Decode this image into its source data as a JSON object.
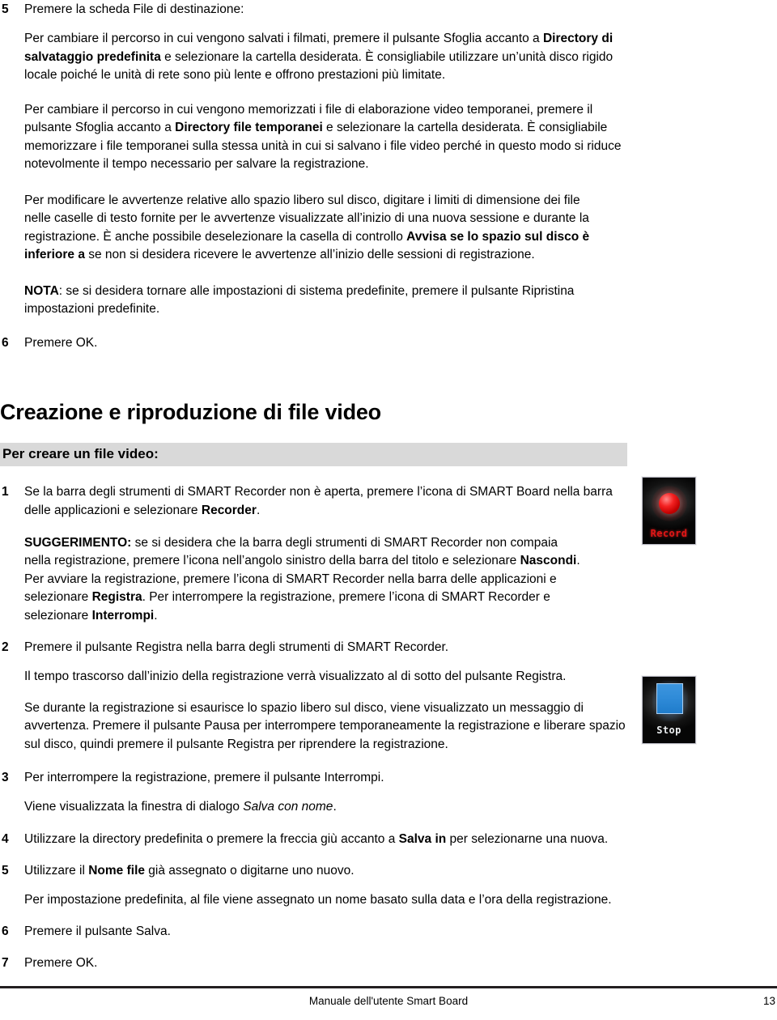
{
  "document": {
    "language": "it",
    "footer": {
      "title": "Manuale dell'utente Smart Board",
      "page_number": "13"
    }
  },
  "steps_top": {
    "step5": {
      "number": "5",
      "text": "Premere la scheda File di destinazione:"
    },
    "para_save_dir": {
      "lead": "Per cambiare il percorso in cui vengono salvati i filmati, premere il pulsante Sfoglia accanto a ",
      "bold": "Directory di salvataggio predefinita",
      "tail": " e selezionare la cartella desiderata. È consigliabile utilizzare un’unità disco rigido locale poiché le unità di rete sono più lente e offrono prestazioni più limitate."
    },
    "para_temp_dir": {
      "lead": "Per cambiare il percorso in cui vengono memorizzati i file di elaborazione video temporanei, premere il pulsante Sfoglia accanto a ",
      "bold": "Directory file temporanei",
      "tail": " e selezionare la cartella desiderata. È consigliabile memorizzare i file temporanei sulla stessa unità in cui si salvano i file video perché in questo modo si riduce notevolmente il tempo necessario per salvare la registrazione."
    },
    "para_disk_warn": {
      "lead": "Per modificare le avvertenze relative allo spazio libero sul disco, digitare i limiti di dimensione dei file nelle caselle di testo fornite per le avvertenze visualizzate all’inizio di una nuova sessione e durante la registrazione. È anche possibile deselezionare la casella di controllo ",
      "bold": "Avvisa se lo spazio sul disco è inferiore a",
      "tail": " se non si desidera ricevere le avvertenze all’inizio delle sessioni di registrazione."
    },
    "para_note": {
      "bold": "NOTA",
      "text": ": se si desidera tornare alle impostazioni di sistema predefinite, premere il pulsante Ripristina impostazioni predefinite."
    },
    "step6": {
      "number": "6",
      "text": "Premere OK."
    }
  },
  "section": {
    "heading": "Creazione e riproduzione di file video",
    "subheading_bar": "Per creare un file video:"
  },
  "steps_bottom": {
    "step1": {
      "number": "1",
      "lead": "Se la barra degli strumenti di SMART Recorder non è aperta, premere l’icona di SMART Board nella barra delle applicazioni e selezionare ",
      "bold": "Recorder",
      "tail": "."
    },
    "para_tip": {
      "bold0": "SUGGERIMENTO:",
      "seg1": " se si desidera che la barra degli strumenti di SMART Recorder non compaia nella registrazione, premere l’icona nell’angolo sinistro della barra del titolo e selezionare ",
      "bold1": "Nascondi",
      "seg2": ". Per avviare la registrazione, premere l’icona di SMART Recorder nella barra delle applicazioni e selezionare ",
      "bold2": "Registra",
      "seg3": ". Per interrompere la registrazione, premere l’icona di SMART Recorder e selezionare ",
      "bold3": "Interrompi",
      "seg4": "."
    },
    "step2": {
      "number": "2",
      "text": "Premere il pulsante Registra nella barra degli strumenti di SMART Recorder."
    },
    "para_elapsed": {
      "text": "Il tempo trascorso dall’inizio della registrazione verrà visualizzato al di sotto del pulsante Registra."
    },
    "para_diskfull": {
      "text": "Se durante la registrazione si esaurisce lo spazio libero sul disco, viene visualizzato un messaggio di avvertenza. Premere il pulsante Pausa per interrompere temporaneamente la registrazione e liberare spazio sul disco, quindi premere il pulsante Registra per riprendere la registrazione."
    },
    "step3": {
      "number": "3",
      "text": "Per interrompere la registrazione, premere il pulsante Interrompi."
    },
    "para_dialog": {
      "lead": "Viene visualizzata la finestra di dialogo ",
      "italic": "Salva con nome",
      "tail": "."
    },
    "step4": {
      "number": "4",
      "lead": "Utilizzare la directory predefinita o premere la freccia giù accanto a ",
      "bold": "Salva in",
      "tail": " per selezionarne una nuova."
    },
    "step5": {
      "number": "5",
      "lead": "Utilizzare il ",
      "bold": "Nome file",
      "tail": " già assegnato o digitarne uno nuovo."
    },
    "para_default_name": {
      "text": "Per impostazione predefinita, al file viene assegnato un nome basato sulla data e l’ora della registrazione."
    },
    "step6": {
      "number": "6",
      "text": "Premere il pulsante Salva."
    },
    "step7": {
      "number": "7",
      "text": "Premere OK."
    }
  },
  "icons": {
    "record": {
      "label": "Record",
      "alt": "record-button-icon",
      "accent": "#e01616"
    },
    "stop": {
      "label": "Stop",
      "alt": "stop-button-icon",
      "accent": "#2f8bd8"
    }
  }
}
